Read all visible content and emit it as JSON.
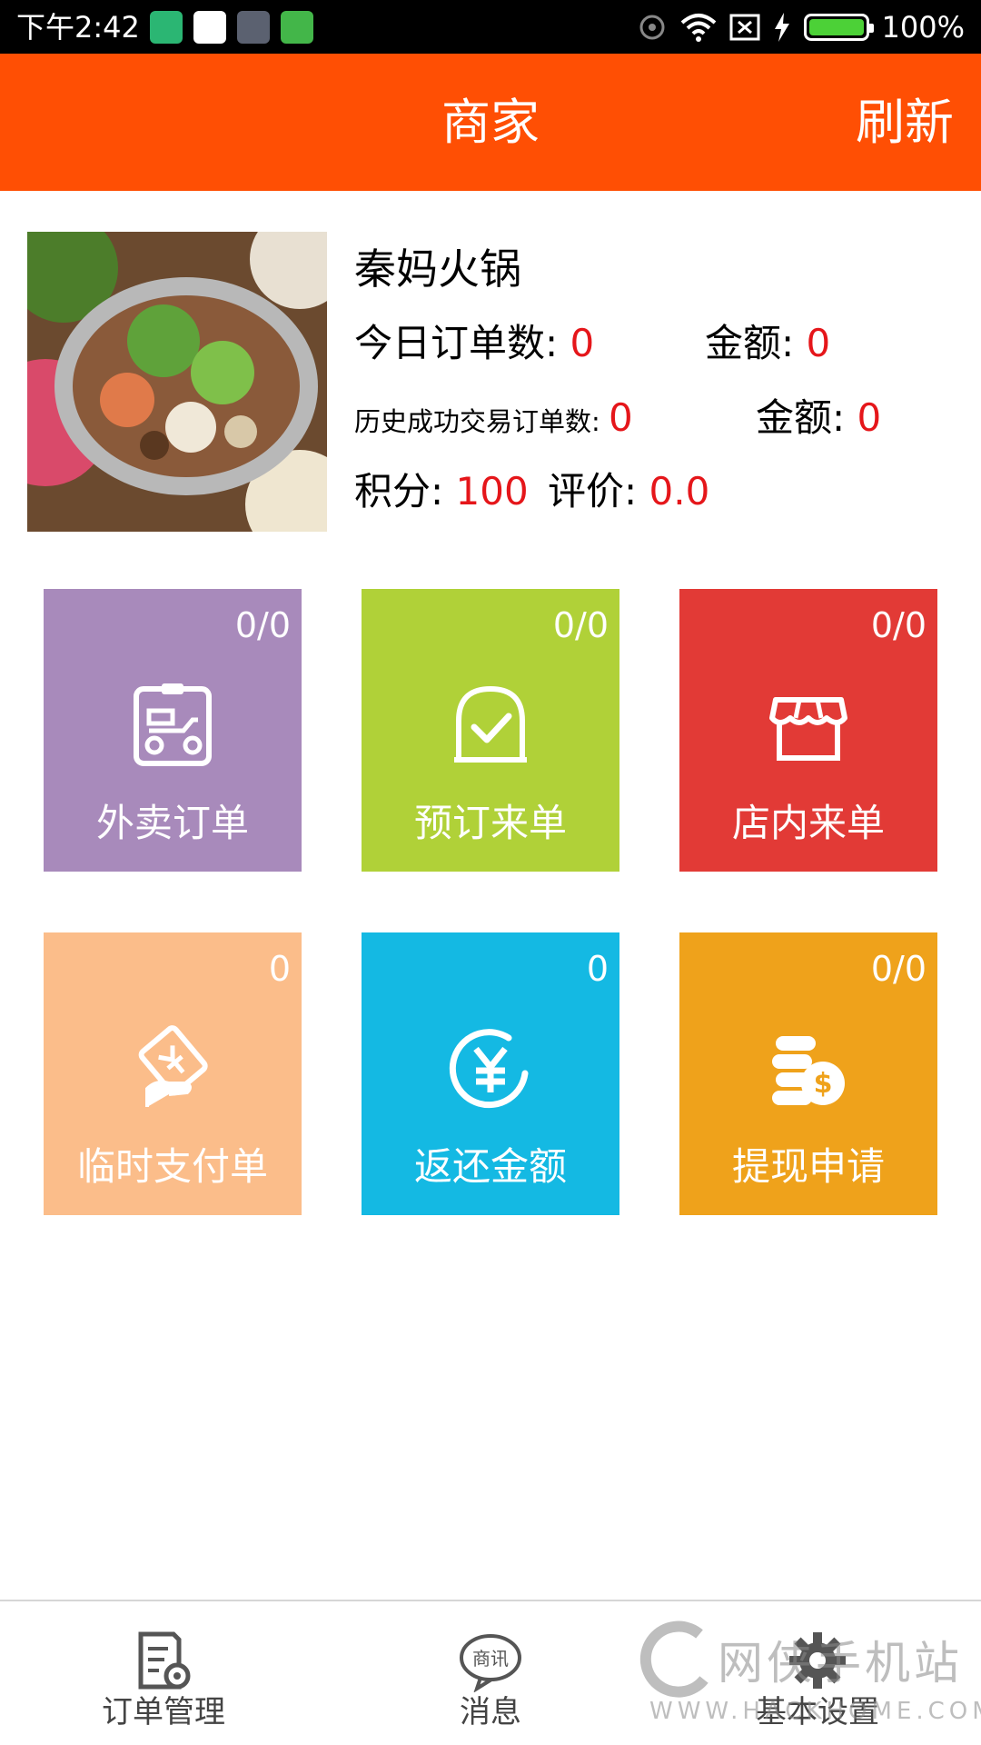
{
  "status_bar": {
    "time": "下午2:42",
    "battery": "100%"
  },
  "header": {
    "title": "商家",
    "refresh_label": "刷新"
  },
  "merchant": {
    "name": "秦妈火锅",
    "today_orders_label": "今日订单数:",
    "today_orders_value": "0",
    "today_amount_label": "金额:",
    "today_amount_value": "0",
    "history_orders_label": "历史成功交易订单数:",
    "history_orders_value": "0",
    "history_amount_label": "金额:",
    "history_amount_value": "0",
    "points_label": "积分:",
    "points_value": "100",
    "rating_label": "评价:",
    "rating_value": "0.0"
  },
  "tiles": [
    {
      "label": "外卖订单",
      "count": "0/0",
      "color": "#a88abb",
      "icon": "delivery-scooter-icon"
    },
    {
      "label": "预订来单",
      "count": "0/0",
      "color": "#b0d138",
      "icon": "checkmark-bag-icon"
    },
    {
      "label": "店内来单",
      "count": "0/0",
      "color": "#e23a36",
      "icon": "storefront-icon"
    },
    {
      "label": "临时支付单",
      "count": "0",
      "color": "#fbbd8a",
      "icon": "hand-card-payment-icon"
    },
    {
      "label": "返还金额",
      "count": "0",
      "color": "#14b9e3",
      "icon": "yuan-circle-icon"
    },
    {
      "label": "提现申请",
      "count": "0/0",
      "color": "#efa21b",
      "icon": "coins-dollar-icon"
    }
  ],
  "bottom_nav": [
    {
      "label": "订单管理",
      "icon": "order-gear-icon"
    },
    {
      "label": "消息",
      "icon": "message-bubble-icon",
      "icon_text": "商讯"
    },
    {
      "label": "基本设置",
      "icon": "settings-gear-icon"
    }
  ],
  "watermark": {
    "text": "网侠手机站",
    "url": "WWW.HACKHOME.COM"
  }
}
